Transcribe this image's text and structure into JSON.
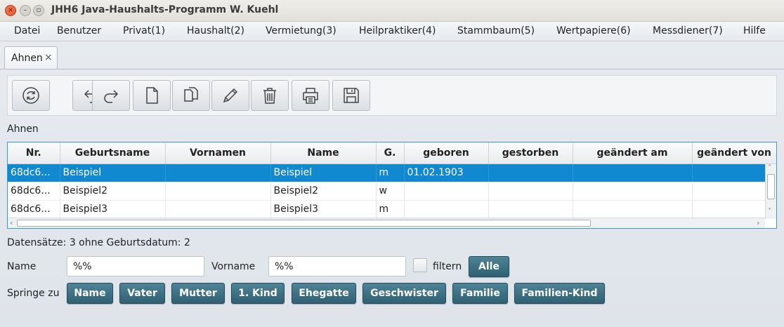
{
  "window": {
    "title": "JHH6 Java-Haushalts-Programm W. Kuehl",
    "close_glyph": "×",
    "min_glyph": "–",
    "max_glyph": "▫"
  },
  "menu": [
    {
      "label": "Datei"
    },
    {
      "label": "Benutzer"
    },
    {
      "label": "Privat(1)"
    },
    {
      "label": "Haushalt(2)"
    },
    {
      "label": "Vermietung(3)"
    },
    {
      "label": "Heilpraktiker(4)"
    },
    {
      "label": "Stammbaum(5)"
    },
    {
      "label": "Wertpapiere(6)"
    },
    {
      "label": "Messdiener(7)"
    },
    {
      "label": "Hilfe"
    }
  ],
  "tab": {
    "label": "Ahnen",
    "close": "×"
  },
  "toolbar": {
    "buttons": [
      {
        "icon": "refresh-icon"
      },
      {
        "icon": "undo-icon"
      },
      {
        "icon": "redo-icon"
      },
      {
        "icon": "new-document-icon"
      },
      {
        "icon": "copy-icon"
      },
      {
        "icon": "edit-pencil-icon"
      },
      {
        "icon": "delete-trash-icon"
      },
      {
        "icon": "print-icon"
      },
      {
        "icon": "save-icon"
      }
    ]
  },
  "section_label": "Ahnen",
  "table": {
    "columns": [
      "Nr.",
      "Geburtsname",
      "Vornamen",
      "Name",
      "G.",
      "geboren",
      "gestorben",
      "geändert am",
      "geändert von"
    ],
    "rows": [
      [
        "68dc6...",
        "Beispiel",
        "",
        "Beispiel",
        "m",
        "01.02.1903",
        "",
        "",
        ""
      ],
      [
        "68dc6...",
        "Beispiel2",
        "",
        "Beispiel2",
        "w",
        "",
        "",
        "",
        ""
      ],
      [
        "68dc6...",
        "Beispiel3",
        "",
        "Beispiel3",
        "m",
        "",
        "",
        "",
        ""
      ]
    ],
    "selected_row": 0,
    "scroll_up": "˄",
    "scroll_down": "˅",
    "scroll_left": "‹",
    "scroll_right": "›"
  },
  "status": "Datensätze: 3  ohne Geburtsdatum: 2",
  "filter": {
    "name_label": "Name",
    "name_value": "%%",
    "vorname_label": "Vorname",
    "vorname_value": "%%",
    "filter_label": "filtern",
    "all_button": "Alle"
  },
  "jump": {
    "label": "Springe zu",
    "buttons": [
      "Name",
      "Vater",
      "Mutter",
      "1. Kind",
      "Ehegatte",
      "Geschwister",
      "Familie",
      "Familien-Kind"
    ]
  },
  "colors": {
    "selection": "#1189d0",
    "accent_button": "#3b6e82",
    "table_border": "#3a9ad9"
  }
}
